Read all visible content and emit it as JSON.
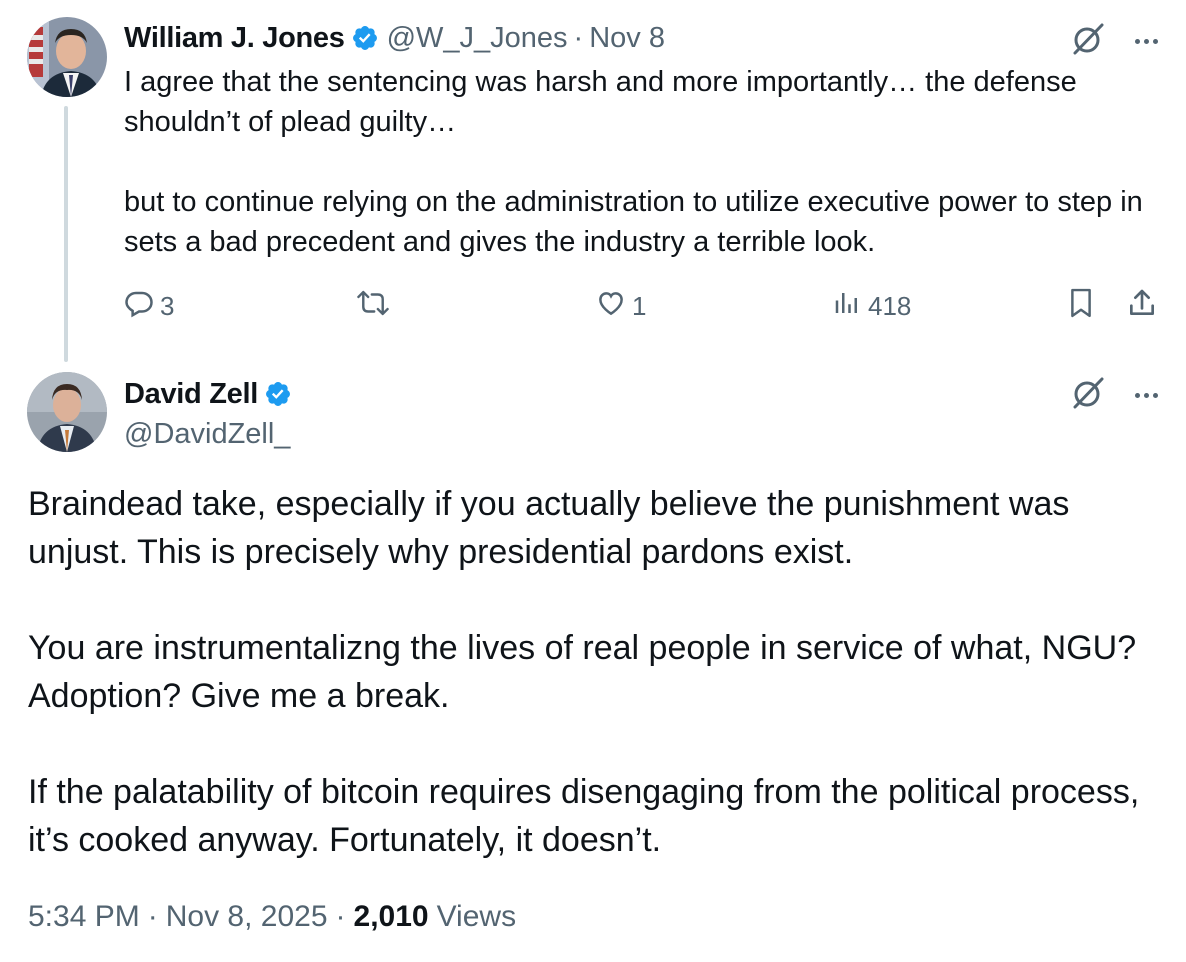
{
  "parent_tweet": {
    "author_name": "William J. Jones",
    "handle": "@W_J_Jones",
    "separator": "·",
    "date": "Nov 8",
    "body": [
      "I agree that the sentencing was harsh and more importantly… the defense shouldn’t of plead guilty…",
      "but to continue relying on the administration to utilize executive power to step in sets a bad precedent and gives the industry a terrible look."
    ],
    "replies": "3",
    "likes": "1",
    "views": "418"
  },
  "main_tweet": {
    "author_name": "David Zell",
    "handle": "@DavidZell_",
    "body": [
      "Braindead take, especially if you actually believe the punishment was unjust. This is precisely why presidential pardons exist.",
      "You are instrumentalizng the lives of real people in service of what, NGU? Adoption? Give me a break.",
      "If the palatability of bitcoin requires disengaging from the political process, it’s cooked anyway. Fortunately, it doesn’t."
    ],
    "time": "5:34 PM",
    "separator": "·",
    "date": "Nov 8, 2025",
    "views_count": "2,010",
    "views_label": "Views"
  },
  "colors": {
    "verified": "#1d9bf0",
    "secondary_text": "#536471",
    "primary_text": "#0f1419",
    "thread_line": "#cfd9de"
  },
  "icons": {
    "reply": "reply-icon",
    "repost": "repost-icon",
    "like": "like-icon",
    "views": "views-icon",
    "bookmark": "bookmark-icon",
    "share": "share-icon",
    "grok": "grok-icon",
    "more": "more-icon",
    "verified": "verified-badge-icon"
  }
}
